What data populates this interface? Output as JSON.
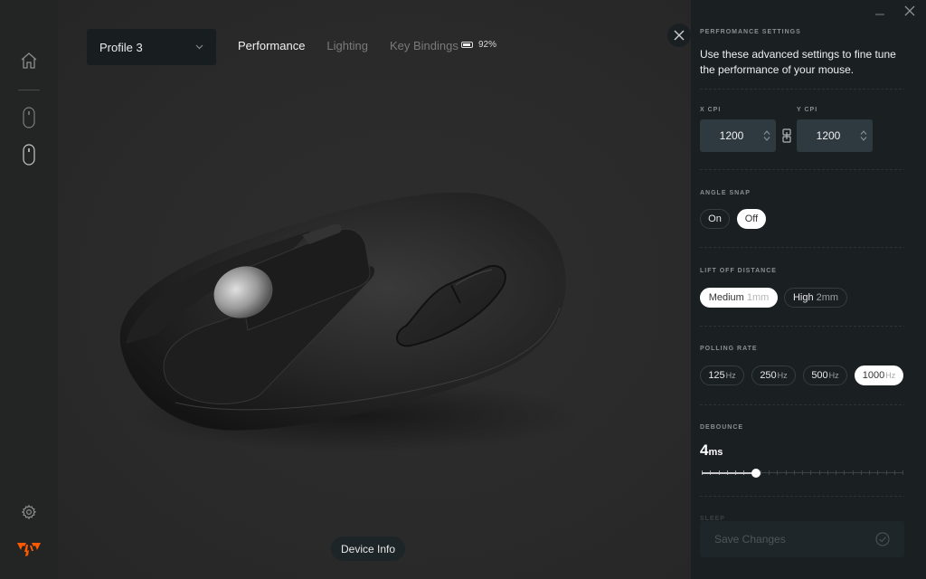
{
  "sidebar": {
    "items": [
      {
        "name": "home",
        "icon": "home-icon"
      },
      {
        "name": "device-1",
        "icon": "mouse-icon"
      },
      {
        "name": "device-2",
        "icon": "mouse-icon",
        "active": true
      }
    ],
    "bottom": [
      {
        "name": "settings",
        "icon": "gear-icon"
      },
      {
        "name": "brand",
        "icon": "fnatic-logo-icon"
      }
    ],
    "brand_color": "#ff5900"
  },
  "header": {
    "profile": {
      "selected": "Profile 3"
    },
    "tabs": [
      {
        "label": "Performance",
        "active": true
      },
      {
        "label": "Lighting",
        "active": false
      },
      {
        "label": "Key Bindings",
        "active": false
      }
    ],
    "battery": {
      "label": "92%",
      "level": 0.92
    }
  },
  "main": {
    "device_info_label": "Device Info"
  },
  "panel": {
    "kicker": "PERFROMANCE SETTINGS",
    "description": "Use these advanced settings to fine tune the performance of your mouse.",
    "cpi": {
      "x_label": "X CPI",
      "y_label": "Y CPI",
      "x_value": "1200",
      "y_value": "1200",
      "linked": true
    },
    "angle_snap": {
      "label": "ANGLE SNAP",
      "options": [
        {
          "label": "On"
        },
        {
          "label": "Off"
        }
      ],
      "selected": "Off"
    },
    "lift_off": {
      "label": "LIFT OFF DISTANCE",
      "options": [
        {
          "label": "Medium",
          "sub": "1mm"
        },
        {
          "label": "High",
          "sub": "2mm"
        }
      ],
      "selected": "Medium"
    },
    "polling": {
      "label": "POLLING RATE",
      "options": [
        {
          "value": "125",
          "unit": "Hz"
        },
        {
          "value": "250",
          "unit": "Hz"
        },
        {
          "value": "500",
          "unit": "Hz"
        },
        {
          "value": "1000",
          "unit": "Hz"
        }
      ],
      "selected": "1000"
    },
    "debounce": {
      "label": "DEBOUNCE",
      "value": "4",
      "unit": "ms",
      "slider_fraction": 0.27,
      "tick_count": 25
    },
    "sleep": {
      "label": "SLEEP"
    },
    "save_label": "Save Changes"
  }
}
